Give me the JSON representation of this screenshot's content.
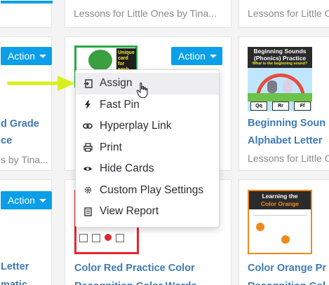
{
  "top_row": {
    "middle_subtitle": "Lessons for Little Ones by Tina...",
    "right_subtitle": "Lessons for Little O"
  },
  "row2": {
    "left": {
      "action_label": "Action",
      "title_line1": "d Grade",
      "title_line2": "ce",
      "subtitle": "s by Tina..."
    },
    "middle": {
      "action_label": "Action",
      "thumb_text": "Unique card for each letter of"
    },
    "right": {
      "thumb_heading": "Beginning Sounds (Phonics) Practice",
      "thumb_question": "What is the beginning sound?",
      "thumb_options": [
        "Qq",
        "Rr",
        "Ff"
      ],
      "title_line1": "Beginning Soun",
      "title_line2": "Alphabet Letter",
      "subtitle": "Lessons for Little O"
    }
  },
  "row3": {
    "left": {
      "action_label": "Action",
      "title_line1": "Letter",
      "title_line2": "matic"
    },
    "middle": {
      "title_line1": "Color Red Practice Color",
      "title_line2": "Recognition Color Words"
    },
    "right": {
      "thumb_heading_part1": "Learning the",
      "thumb_heading_part2": "Color Orange",
      "title_line1": "Color Orange Pr",
      "title_line2": "Recognition Col"
    }
  },
  "menu": {
    "items": [
      {
        "label": "Assign",
        "icon": "assign-icon"
      },
      {
        "label": "Fast Pin",
        "icon": "lightning-icon"
      },
      {
        "label": "Hyperplay Link",
        "icon": "link-icon"
      },
      {
        "label": "Print",
        "icon": "printer-icon"
      },
      {
        "label": "Hide Cards",
        "icon": "eye-icon"
      },
      {
        "label": "Custom Play Settings",
        "icon": "gear-icon"
      },
      {
        "label": "View Report",
        "icon": "report-icon"
      }
    ]
  },
  "colors": {
    "accent": "#0a9fe8",
    "title": "#3d7ab5",
    "subtitle": "#8a8a8f",
    "annotation_arrow": "#d7f01c"
  }
}
